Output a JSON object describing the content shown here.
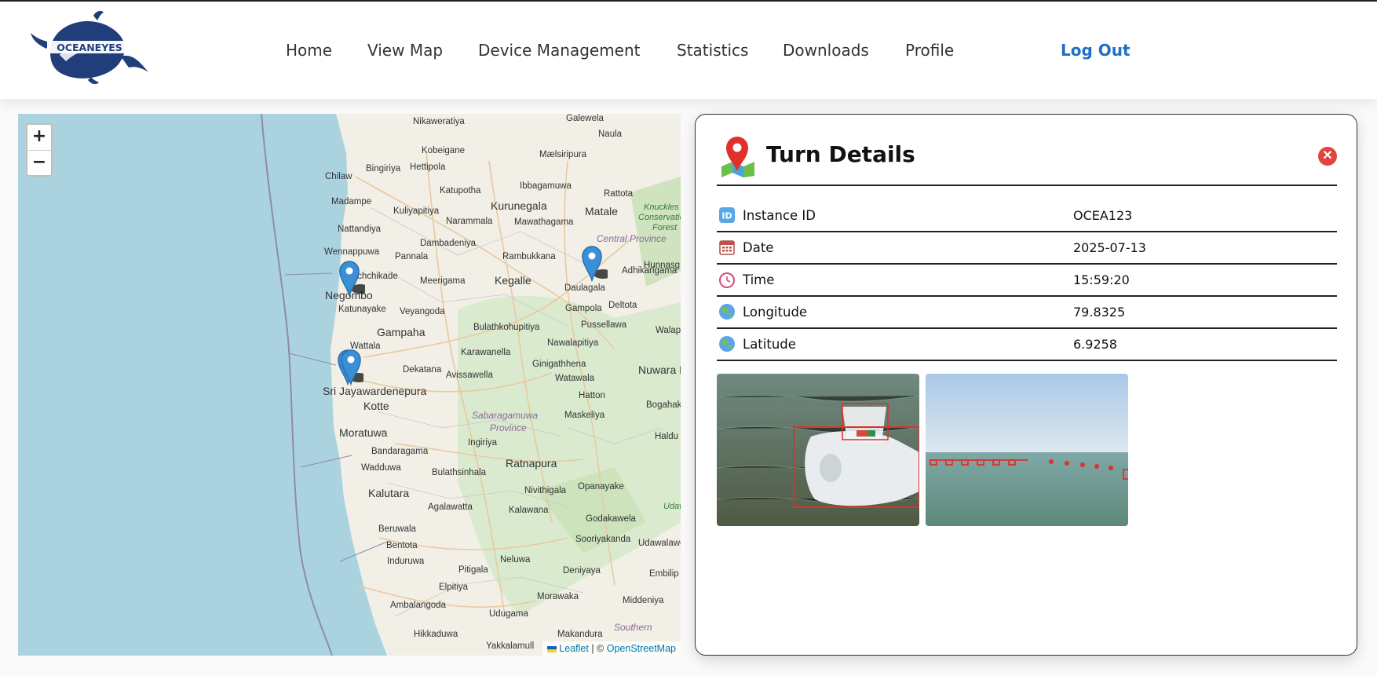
{
  "brand": {
    "name": "OCEANEYES"
  },
  "nav": {
    "home": "Home",
    "view_map": "View Map",
    "device_management": "Device Management",
    "statistics": "Statistics",
    "downloads": "Downloads",
    "profile": "Profile",
    "logout": "Log Out"
  },
  "map": {
    "zoom_in": "+",
    "zoom_out": "−",
    "attribution": {
      "leaflet": "Leaflet",
      "separator": " | © ",
      "osm": "OpenStreetMap"
    },
    "places": {
      "nikaweratiya": "Nikaweratiya",
      "galewela": "Galewela",
      "kobeigane": "Kobeigane",
      "naula": "Naula",
      "chilaw": "Chilaw",
      "bingiriya": "Bingiriya",
      "hettipola": "Hettipola",
      "maelsiripura": "Mælsiripura",
      "katupotha": "Katupotha",
      "ibbagamuwa": "Ibbagamuwa",
      "rattota": "Rattota",
      "madampe": "Madampe",
      "kuliyapitiya": "Kuliyapitiya",
      "narammala": "Narammala",
      "kurunegala": "Kurunegala",
      "matale": "Matale",
      "knuckles": "Knuckles",
      "conservation": "Conservation",
      "forest": "Forest",
      "nattandiya": "Nattandiya",
      "mawathagama": "Mawathagama",
      "dambadeniya": "Dambadeniya",
      "central_province": "Central Province",
      "wennappuwa": "Wennappuwa",
      "pannala": "Pannala",
      "rambukkana": "Rambukkana",
      "hunnasg": "Hunnasg",
      "kochchikade": "Kochchikade",
      "meerigama": "Meerigama",
      "kegalle": "Kegalle",
      "daulagala": "Daulagala",
      "adhikarigama": "Adhikarigama",
      "negombo": "Negombo",
      "katunayake": "Katunayake",
      "veyangoda": "Veyangoda",
      "gampola": "Gampola",
      "deltota": "Deltota",
      "gampaha": "Gampaha",
      "bulathkohupitiya": "Bulathkohupitiya",
      "pussellawa": "Pussellawa",
      "walap": "Walap",
      "wattala": "Wattala",
      "karawanella": "Karawanella",
      "nawalapitiya": "Nawalapitiya",
      "dekatana": "Dekatana",
      "ginigathhena": "Ginigathhena",
      "avissawella": "Avissawella",
      "watawala": "Watawala",
      "nuwara_eliya": "Nuwara Eliya",
      "sri_jayawardenepura": "Sri Jayawardenepura",
      "kotte": "Kotte",
      "hatton": "Hatton",
      "bogahak": "Bogahak",
      "sabaragamuwa": "Sabaragamuwa",
      "province": "Province",
      "maskeliya": "Maskeliya",
      "moratuwa": "Moratuwa",
      "haldu": "Haldu",
      "ingiriya": "Ingiriya",
      "bandaragama": "Bandaragama",
      "ratnapura": "Ratnapura",
      "wadduwa": "Wadduwa",
      "bulathsinhala": "Bulathsinhala",
      "opanayake": "Opanayake",
      "kalutara": "Kalutara",
      "nivithigala": "Nivithigala",
      "agalawatta": "Agalawatta",
      "kalawana": "Kalawana",
      "udaw": "Udaw",
      "beruwala": "Beruwala",
      "godakawela": "Godakawela",
      "bentota": "Bentota",
      "sooriyakanda": "Sooriyakanda",
      "udawalawe": "Udawalawe",
      "induruwa": "Induruwa",
      "neluwa": "Neluwa",
      "pitigala": "Pitigala",
      "deniyaya": "Deniyaya",
      "embilip": "Embilip",
      "elpitiya": "Elpitiya",
      "morawaka": "Morawaka",
      "middeniya": "Middeniya",
      "ambalangoda": "Ambalangoda",
      "udugama": "Udugama",
      "southern": "Southern",
      "hikkaduwa": "Hikkaduwa",
      "makandura": "Makandura",
      "yakkalamull": "Yakkalamull"
    }
  },
  "panel": {
    "title": "Turn Details",
    "rows": [
      {
        "icon": "id-icon",
        "label": "Instance ID",
        "value": "OCEA123"
      },
      {
        "icon": "calendar-icon",
        "label": "Date",
        "value": "2025-07-13"
      },
      {
        "icon": "clock-icon",
        "label": "Time",
        "value": "15:59:20"
      },
      {
        "icon": "globe-icon",
        "label": "Longitude",
        "value": "79.8325"
      },
      {
        "icon": "globe-icon",
        "label": "Latitude",
        "value": "6.9258"
      }
    ]
  },
  "colors": {
    "accent": "#1e6fc8",
    "close": "#e0463c",
    "sea": "#aad3df",
    "marker": "#3a8fd6"
  }
}
